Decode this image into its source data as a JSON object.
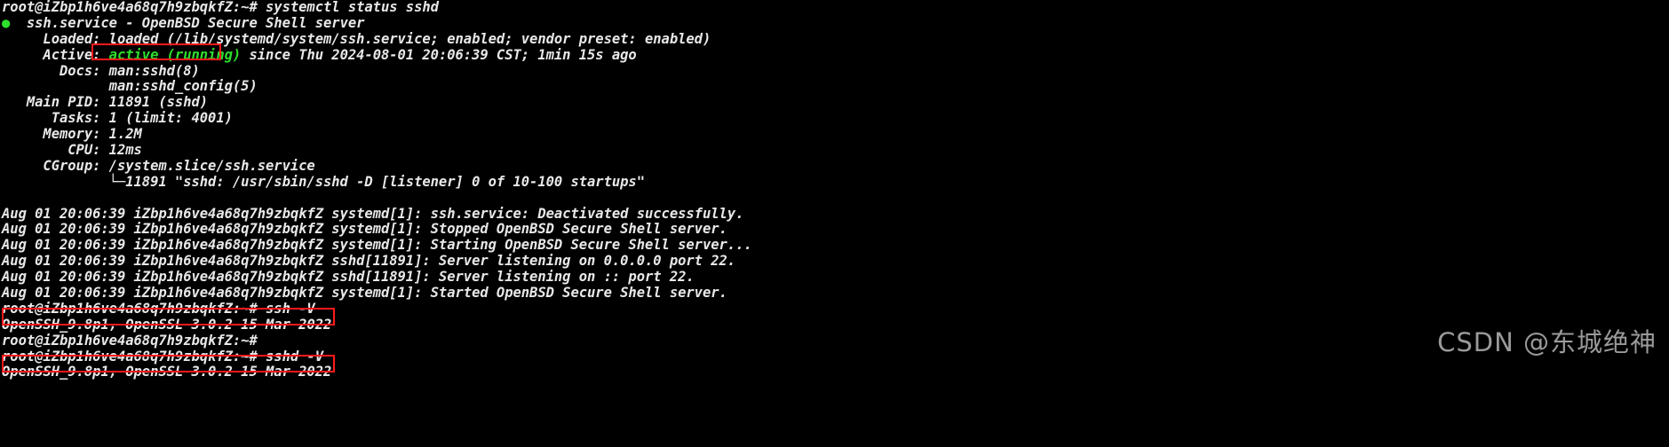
{
  "terminal": {
    "prompt": "root@iZbp1h6ve4a68q7h9zbqkfZ:~#",
    "bullet": "●",
    "lines": {
      "cmd_status": "root@iZbp1h6ve4a68q7h9zbqkfZ:~# systemctl status sshd",
      "service_header": "  ssh.service - OpenBSD Secure Shell server",
      "loaded": "     Loaded: loaded (/lib/systemd/system/ssh.service; enabled; vendor preset: enabled)",
      "active_label": "     Active: ",
      "active_value": "active (running)",
      "active_rest": " since Thu 2024-08-01 20:06:39 CST; 1min 15s ago",
      "docs": "       Docs: man:sshd(8)",
      "docs2": "             man:sshd_config(5)",
      "main_pid": "   Main PID: 11891 (sshd)",
      "tasks": "      Tasks: 1 (limit: 4001)",
      "memory": "     Memory: 1.2M",
      "cpu": "        CPU: 12ms",
      "cgroup": "     CGroup: /system.slice/ssh.service",
      "cgroup_proc": "             └─11891 \"sshd: /usr/sbin/sshd -D [listener] 0 of 10-100 startups\"",
      "log1": "Aug 01 20:06:39 iZbp1h6ve4a68q7h9zbqkfZ systemd[1]: ssh.service: Deactivated successfully.",
      "log2": "Aug 01 20:06:39 iZbp1h6ve4a68q7h9zbqkfZ systemd[1]: Stopped OpenBSD Secure Shell server.",
      "log3": "Aug 01 20:06:39 iZbp1h6ve4a68q7h9zbqkfZ systemd[1]: Starting OpenBSD Secure Shell server...",
      "log4": "Aug 01 20:06:39 iZbp1h6ve4a68q7h9zbqkfZ sshd[11891]: Server listening on 0.0.0.0 port 22.",
      "log5": "Aug 01 20:06:39 iZbp1h6ve4a68q7h9zbqkfZ sshd[11891]: Server listening on :: port 22.",
      "log6": "Aug 01 20:06:39 iZbp1h6ve4a68q7h9zbqkfZ systemd[1]: Started OpenBSD Secure Shell server.",
      "cmd_ssh_v": "root@iZbp1h6ve4a68q7h9zbqkfZ:~# ssh -V",
      "out_ssh_v": "OpenSSH_9.8p1, OpenSSL 3.0.2 15 Mar 2022",
      "prompt_empty": "root@iZbp1h6ve4a68q7h9zbqkfZ:~#",
      "cmd_sshd_v": "root@iZbp1h6ve4a68q7h9zbqkfZ:~# sshd -V",
      "out_sshd_v": "OpenSSH_9.8p1, OpenSSL 3.0.2 15 Mar 2022"
    },
    "watermark": "CSDN @东城绝神",
    "colors": {
      "background": "#000000",
      "foreground": "#e8e8e8",
      "active_green": "#2ee02e",
      "annotation_red": "#ff1a1a",
      "watermark_gray": "#9a9a9a"
    }
  }
}
